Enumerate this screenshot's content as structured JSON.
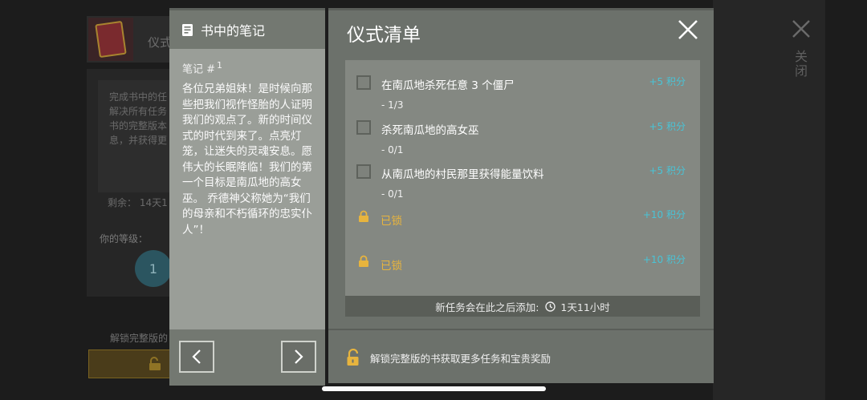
{
  "background": {
    "title": "仪式",
    "description_lines": [
      "完成书中的任",
      "解决所有任务",
      "书的完整版本",
      "息，并获得更"
    ],
    "remaining": "剩余：  14天1",
    "level_label": "你的等级：",
    "level_value": "1",
    "unlock_text": "解锁完整版的"
  },
  "notes": {
    "title": "书中的笔记",
    "note_label": "笔记 #",
    "note_number": "1",
    "note_text": "各位兄弟姐妹！是时候向那些把我们视作怪胎的人证明我们的观点了。新的时间仪式的时代到来了。点亮灯笼，让迷失的灵魂安息。愿伟大的长眠降临！我们的第一个目标是南瓜地的高女巫。 乔德神父称她为“我们的母亲和不朽循环的忠实仆人”！"
  },
  "ritual": {
    "title": "仪式清单",
    "tasks": [
      {
        "label": "在南瓜地杀死任意 3 个僵尸",
        "progress": "- 1/3",
        "reward": "+5  积分"
      },
      {
        "label": "杀死南瓜地的高女巫",
        "progress": "- 0/1",
        "reward": "+5  积分"
      },
      {
        "label": "从南瓜地的村民那里获得能量饮料",
        "progress": "- 0/1",
        "reward": "+5  积分"
      }
    ],
    "locked": [
      {
        "label": "已锁",
        "reward": "+10  积分"
      },
      {
        "label": "已锁",
        "reward": "+10  积分"
      }
    ],
    "new_task_text": "新任务会在此之后添加:",
    "new_task_time": "1天11小时",
    "unlock_text": "解锁完整版的书获取更多任务和宝贵奖励"
  },
  "side": {
    "close_label": "关闭"
  },
  "colors": {
    "reward": "#49c3d6",
    "locked": "#e7b43e",
    "panel": "#6c716b"
  }
}
